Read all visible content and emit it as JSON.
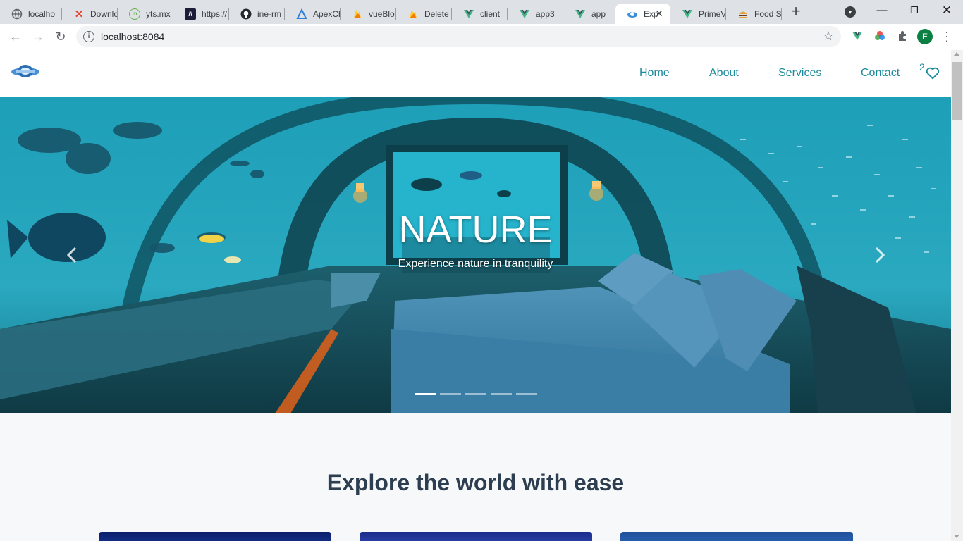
{
  "browser": {
    "tabs": [
      {
        "title": "localho",
        "icon": "globe-icon"
      },
      {
        "title": "Downlo",
        "icon": "x-logo-icon"
      },
      {
        "title": "yts.mx",
        "icon": "yts-icon"
      },
      {
        "title": "https://",
        "icon": "code-icon"
      },
      {
        "title": "ine-rm",
        "icon": "github-icon"
      },
      {
        "title": "ApexCh",
        "icon": "apex-icon"
      },
      {
        "title": "vueBlo",
        "icon": "firebase-icon"
      },
      {
        "title": "Delete",
        "icon": "firebase-icon"
      },
      {
        "title": "client",
        "icon": "vue-icon"
      },
      {
        "title": "app3",
        "icon": "vue-icon"
      },
      {
        "title": "app",
        "icon": "vue-icon"
      },
      {
        "title": "Exp",
        "icon": "site-logo-icon",
        "active": true
      },
      {
        "title": "PrimeV",
        "icon": "vue-icon"
      },
      {
        "title": "Food S",
        "icon": "burger-icon"
      }
    ],
    "url": "localhost:8084"
  },
  "site": {
    "nav": {
      "home": "Home",
      "about": "About",
      "services": "Services",
      "contact": "Contact"
    },
    "favorites_count": "2",
    "hero": {
      "title": "NATURE",
      "subtitle": "Experience nature in tranquility",
      "slide_count": 5,
      "active_slide": 1
    },
    "section_title": "Explore the world with ease"
  },
  "colors": {
    "accent": "#1b8a9c",
    "heading": "#2c3e50",
    "water": "#2aa9c0"
  }
}
